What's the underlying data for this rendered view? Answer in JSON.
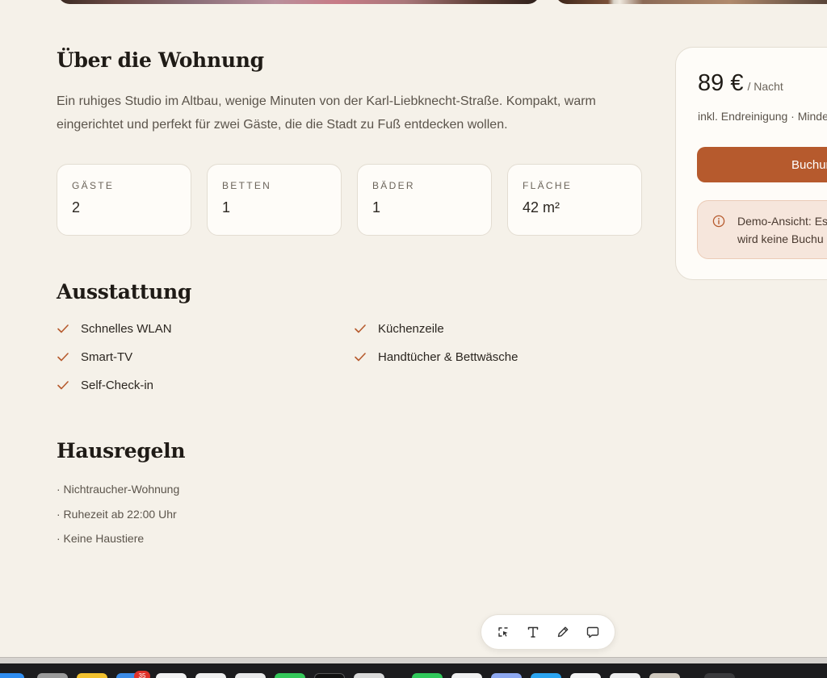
{
  "about": {
    "title": "Über die Wohnung",
    "description": "Ein ruhiges Studio im Altbau, wenige Minuten von der Karl-Liebknecht-Straße. Kompakt, warm eingerichtet und perfekt für zwei Gäste, die die Stadt zu Fuß entdecken wollen."
  },
  "stats": [
    {
      "label": "GÄSTE",
      "value": "2"
    },
    {
      "label": "BETTEN",
      "value": "1"
    },
    {
      "label": "BÄDER",
      "value": "1"
    },
    {
      "label": "FLÄCHE",
      "value": "42 m²"
    }
  ],
  "amenities": {
    "title": "Ausstattung",
    "items": [
      "Schnelles WLAN",
      "Küchenzeile",
      "Smart-TV",
      "Handtücher & Bettwäsche",
      "Self-Check-in"
    ]
  },
  "rules": {
    "title": "Hausregeln",
    "items": [
      "· Nichtraucher-Wohnung",
      "· Ruhezeit ab 22:00 Uhr",
      "· Keine Haustiere"
    ]
  },
  "booking": {
    "price": "89 €",
    "per_night": "/ Nacht",
    "note": "inkl. Endreinigung · Minde",
    "button_label": "Buchun",
    "demo_line1": "Demo-Ansicht: Es",
    "demo_line2": "wird keine Buchu"
  },
  "toolbar": {
    "tools": [
      "lasso-select-icon",
      "text-icon",
      "pencil-icon",
      "comment-icon"
    ]
  },
  "dock": {
    "badge": "35"
  },
  "colors": {
    "accent": "#b65a2d",
    "background": "#f5f1e9",
    "card": "#fefcf8",
    "demo_bg": "#f6e6dc"
  }
}
